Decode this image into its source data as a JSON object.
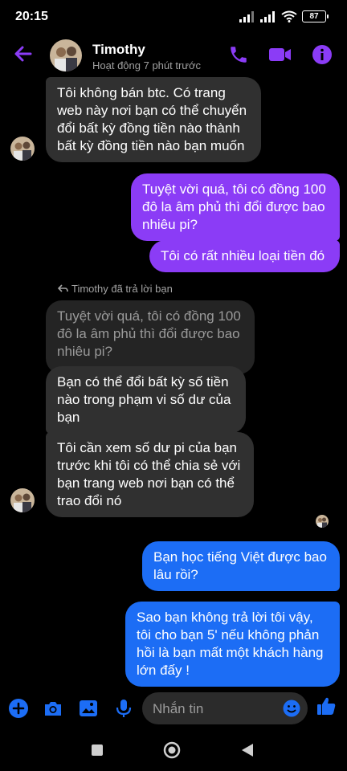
{
  "status_bar": {
    "time": "20:15",
    "battery": "87"
  },
  "header": {
    "contact_name": "Timothy",
    "contact_status": "Hoạt động 7 phút trước"
  },
  "messages": [
    {
      "sender": "contact",
      "text_lines": [
        "Tôi không bán btc. Có trang",
        "web này nơi bạn có thể chuyển",
        "đổi bất kỳ đồng tiền nào thành",
        "bất kỳ đồng tiền nào bạn muốn"
      ]
    },
    {
      "sender": "me",
      "text_lines": [
        "Tuyệt vời quá, tôi có đồng 100",
        "đô la âm phủ thì đổi được bao",
        "nhiêu pi?"
      ]
    },
    {
      "sender": "me",
      "text_lines": [
        "Tôi có rất nhiều loại tiền đó"
      ]
    },
    {
      "sender": "contact",
      "text_lines": [
        "Bạn có thể đổi bất kỳ số tiền",
        "nào trong phạm vi số dư của",
        "bạn"
      ]
    },
    {
      "sender": "contact",
      "text_lines": [
        "Tôi cần xem số dư pi của bạn",
        "trước khi tôi có thể chia sẻ với",
        "bạn trang web nơi bạn có thể",
        "trao đổi nó"
      ]
    },
    {
      "sender": "me",
      "text_lines": [
        "Bạn học tiếng Việt được bao",
        "lâu rồi?"
      ]
    },
    {
      "sender": "me",
      "text_lines": [
        "Sao bạn không trả lời tôi vậy,",
        "tôi cho bạn 5' nếu không phản",
        "hồi là bạn mất một khách hàng",
        "lớn đấy !"
      ]
    }
  ],
  "reply_info": {
    "label": "Timothy đã trả lời bạn",
    "quoted_lines": [
      "Tuyệt vời quá, tôi có đồng 100",
      "đô la âm phủ thì đổi được bao",
      "nhiêu pi?"
    ]
  },
  "composer": {
    "placeholder": "Nhắn tin"
  },
  "colors": {
    "accent": "#8b3cf6",
    "outgoing_purple": "#8b3cf6",
    "outgoing_blue": "#1c6df5",
    "incoming": "#303030",
    "background": "#000000"
  },
  "icons": [
    "back-arrow-icon",
    "phone-icon",
    "video-camera-icon",
    "info-icon",
    "plus-icon",
    "camera-icon",
    "image-icon",
    "microphone-icon",
    "emoji-icon",
    "thumbs-up-icon",
    "reply-arrow-icon"
  ]
}
